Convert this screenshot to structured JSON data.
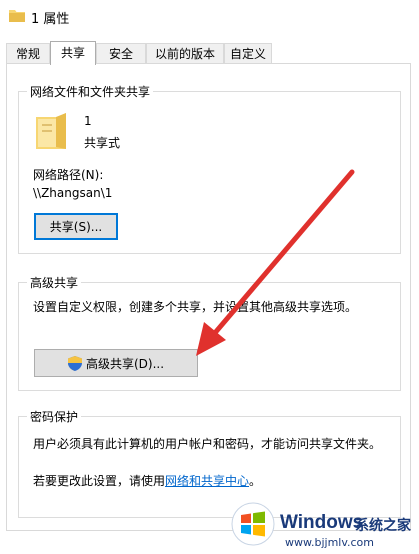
{
  "window": {
    "title": "1 属性"
  },
  "tabs": [
    {
      "label": "常规"
    },
    {
      "label": "共享"
    },
    {
      "label": "安全"
    },
    {
      "label": "以前的版本"
    },
    {
      "label": "自定义"
    }
  ],
  "network_sharing": {
    "legend": "网络文件和文件夹共享",
    "folder_name": "1",
    "share_status": "共享式",
    "path_label": "网络路径(N):",
    "path_value": "\\\\Zhangsan\\1",
    "share_button": "共享(S)..."
  },
  "advanced_sharing": {
    "legend": "高级共享",
    "description": "设置自定义权限，创建多个共享，并设置其他高级共享选项。",
    "button": "高级共享(D)..."
  },
  "password_protection": {
    "legend": "密码保护",
    "description": "用户必须具有此计算机的用户帐户和密码，才能访问共享文件夹。",
    "change_prefix": "若要更改此设置，请使用",
    "change_link": "网络和共享中心",
    "change_suffix": "。"
  },
  "watermark": {
    "brand": "Windows",
    "site_name": "系统之家",
    "url": "www.bjjmlv.com"
  },
  "colors": {
    "accent": "#0078d7",
    "arrow": "#e0312d",
    "link": "#0066cc"
  }
}
